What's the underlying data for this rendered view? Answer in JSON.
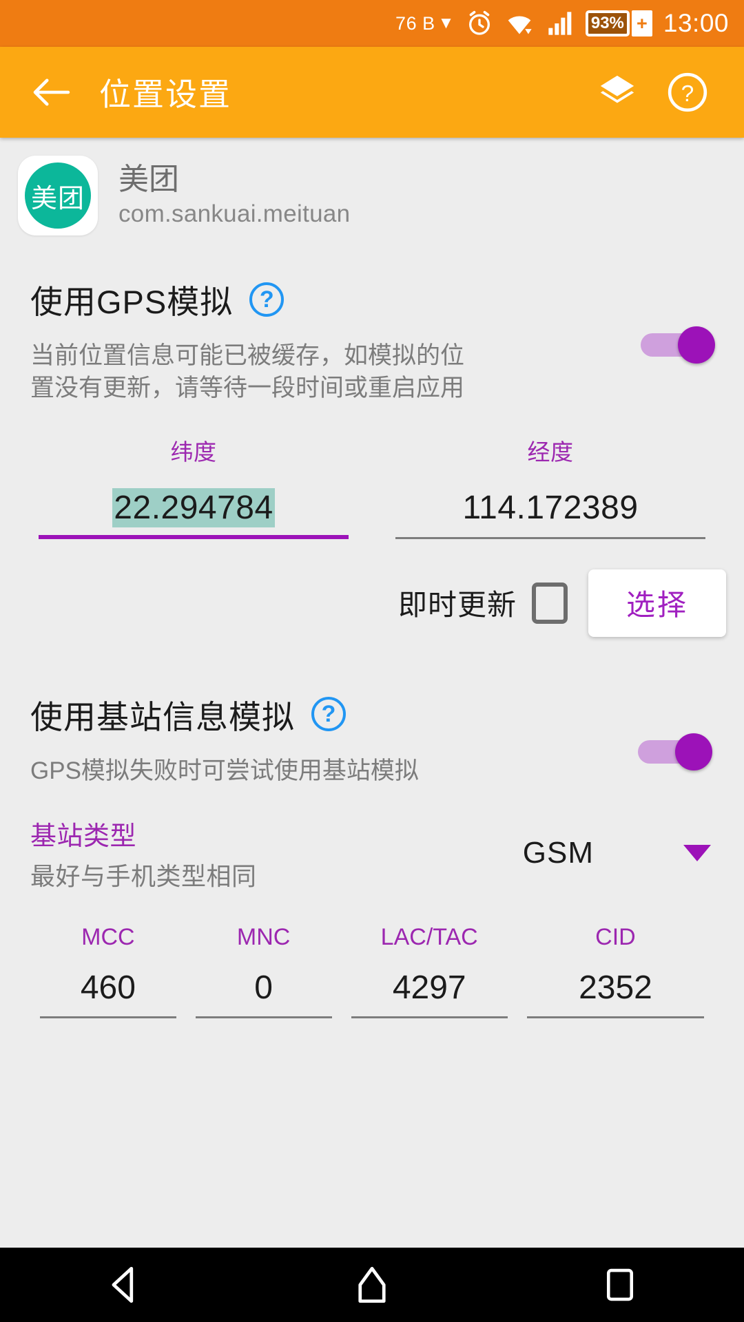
{
  "statusbar": {
    "network_speed": "76 B",
    "network_caret": "▼",
    "battery_percent": "93%",
    "battery_plus": "+",
    "time": "13:00",
    "icons": [
      "alarm-icon",
      "wifi-icon",
      "signal-icon",
      "battery-icon"
    ]
  },
  "appbar": {
    "back_icon": "back-arrow-icon",
    "title": "位置设置",
    "layers_icon": "layers-icon",
    "help_icon": "help-circle-icon"
  },
  "app": {
    "icon_text": "美团",
    "name": "美团",
    "package": "com.sankuai.meituan"
  },
  "gps_section": {
    "title": "使用GPS模拟",
    "help_glyph": "?",
    "description": "当前位置信息可能已被缓存，如模拟的位置没有更新，请等待一段时间或重启应用",
    "toggle_on": true,
    "latitude_label": "纬度",
    "latitude_value": "22.294784",
    "longitude_label": "经度",
    "longitude_value": "114.172389",
    "instant_update_label": "即时更新",
    "instant_update_checked": false,
    "select_button": "选择"
  },
  "cell_section": {
    "title": "使用基站信息模拟",
    "help_glyph": "?",
    "description": "GPS模拟失败时可尝试使用基站模拟",
    "toggle_on": true,
    "type_label": "基站类型",
    "type_hint": "最好与手机类型相同",
    "type_value": "GSM",
    "fields": [
      {
        "label": "MCC",
        "value": "460"
      },
      {
        "label": "MNC",
        "value": "0"
      },
      {
        "label": "LAC/TAC",
        "value": "4297"
      },
      {
        "label": "CID",
        "value": "2352"
      }
    ]
  },
  "navbar": {
    "back": "nav-back-icon",
    "home": "nav-home-icon",
    "recents": "nav-recents-icon"
  },
  "colors": {
    "status_bar": "#ef7c12",
    "app_bar": "#fca812",
    "accent_purple": "#9c27b0",
    "toggle_on": "#9c12b8",
    "help_blue": "#2196f3",
    "selection_teal": "#9ecfc6",
    "app_icon_green": "#0cb79a",
    "background": "#ededed"
  }
}
